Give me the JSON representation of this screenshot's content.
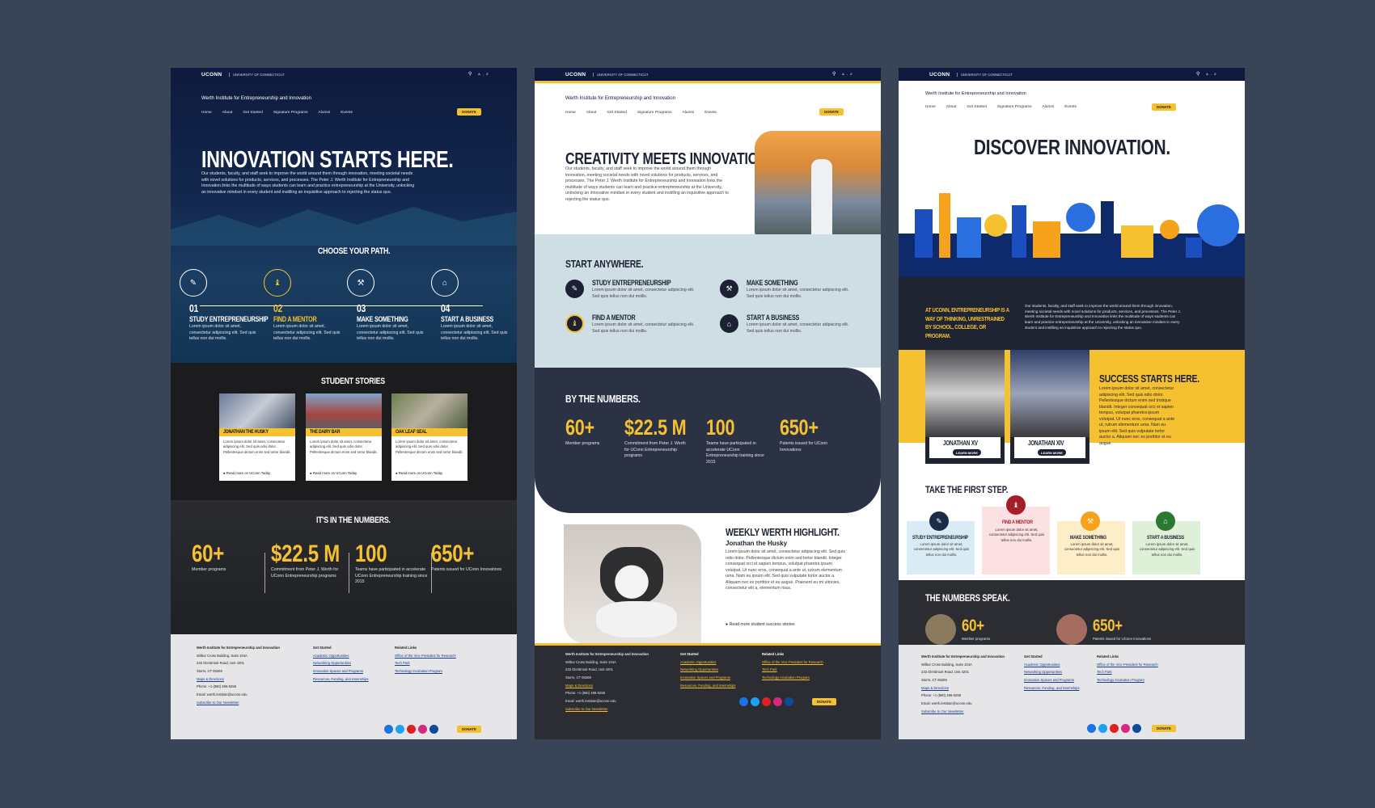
{
  "brand": {
    "logo": "UCONN",
    "university": "UNIVERSITY OF CONNECTICUT",
    "site": "Werth Institute for Entrepreneurship and Innovation",
    "search_icon": "⚲",
    "az": "A-Z"
  },
  "nav": [
    "Home",
    "About",
    "Get Started",
    "Signature Programs",
    "Alumni",
    "Events"
  ],
  "donate": "DONATE",
  "intro": "Our students, faculty, and staff seek to improve the world around them through innovation, meeting societal needs with novel solutions for products, services, and processes. The Peter J. Werth Institute for Entrepreneurship and Innovation links the multitude of ways students can learn and practice entrepreneurship at the University, unlocking an innovative mindset in every student and instilling an inquisitive approach to rejecting the status quo.",
  "lorem_short": "Lorem ipsum dolor sit amet, consectetur adipiscing elit. Sed quis tellus non dui mollis.",
  "paths": [
    {
      "num": "01",
      "title": "STUDY ENTREPRENEURSHIP"
    },
    {
      "num": "02",
      "title": "FIND A MENTOR"
    },
    {
      "num": "03",
      "title": "MAKE SOMETHING"
    },
    {
      "num": "04",
      "title": "START A BUSINESS"
    }
  ],
  "stats": [
    {
      "value": "60+",
      "label": "Member programs"
    },
    {
      "value": "$22.5 M",
      "label": "Commitment from Peter J. Werth for UConn Entrepreneurship programs"
    },
    {
      "value": "100",
      "label": "Teams have participated in accelerate UConn Entrepreneurship training since 2015"
    },
    {
      "value": "650+",
      "label": "Patents issued for UConn Innovations"
    }
  ],
  "p1": {
    "hero": "INNOVATION STARTS HERE.",
    "choose": "CHOOSE YOUR PATH.",
    "stories_title": "STUDENT STORIES",
    "stories": [
      {
        "title": "JONATHAN THE HUSKY"
      },
      {
        "title": "THE DAIRY BAR"
      },
      {
        "title": "OAK LEAF SEAL"
      }
    ],
    "story_body": "Lorem ipsum dolor sit amet, consectetur adipiscing elit. Sed quis odio dolor. Pellentesque dictum enim sed tortor blandit.",
    "read_more": "Read more on UConn Today",
    "numbers_title": "IT'S IN THE NUMBERS."
  },
  "p2": {
    "hero": "CREATIVITY MEETS INNOVATION.",
    "start": "START ANYWHERE.",
    "by_numbers": "BY THE NUMBERS.",
    "weekly": "WEEKLY WERTH HIGHLIGHT.",
    "husky": "Jonathan the Husky",
    "husky_body": "Lorem ipsum dolor sit amet, consectetur adipiscing elit. Sed quis odio dolor. Pellentesque dictum enim sed tortor blandit. Integer consequat orci et sapien tempus, volutpat pharetra ipsum volutpat. Ut nunc eros, consequat a ante ut, rutrum elementum urna. Nam eu ipsum elit. Sed quis vulputate tortor auctor a. Aliquam nec ex porttitor et eu augue. Praesent eu mi ultricies, consectetur elit a, elementum risus.",
    "read_more": "Read more student success stories"
  },
  "p3": {
    "hero": "DISCOVER INNOVATION.",
    "lead": "AT UCONN, ENTREPRENEURSHIP IS A WAY OF THINKING, UNRESTRAINED BY SCHOOL, COLLEGE, OR PROGRAM.",
    "dogs": [
      {
        "name": "JONATHAN XV",
        "btn": "LEARN MORE"
      },
      {
        "name": "JONATHAN XIV",
        "btn": "LEARN MORE"
      }
    ],
    "success": "SUCCESS STARTS HERE.",
    "success_body": "Lorem ipsum dolor sit amet, consectetur adipiscing elit. Sed quis odio dolor. Pellentesque dictum enim sed tristique blandit. Integer consequat orci et sapien tempus, volutpat pharetra ipsum volutpat. Ut nunc eros, consequat a ante ut, rutrum elementum urna. Nam eu ipsum elit. Sed quis vulputate tortor auctor a. Aliquam nec ex porttitor et eu augue.",
    "first_step": "TAKE THE FIRST STEP.",
    "numbers_speak": "THE NUMBERS SPEAK."
  },
  "footer": {
    "title": "Werth Institute for Entrepreneurship and Innovation",
    "addr1": "Wilbur Cross Building, Suite 104A",
    "addr2": "233 Glenbrook Road, Unit 4201",
    "addr3": "Storrs, CT 06269",
    "maps": "Maps & Directions",
    "phone": "Phone: +1 (860) 486-5258",
    "email": "Email: werth.institute@uconn.edu",
    "subscribe": "Subscribe to Our Newsletter",
    "gs_title": "Get Started",
    "gs": [
      "Academic Opportunities",
      "Networking Opportunities",
      "Innovation Spaces and Programs",
      "Resources, Funding, and Internships"
    ],
    "rl_title": "Related Links",
    "rl": [
      "Office of the Vice President for Research",
      "Tech Park",
      "Technology Incubation Program"
    ]
  },
  "colors": {
    "navy": "#0e1a3d",
    "gold": "#f6c131",
    "slate": "#2b3244",
    "page_bg": "#3a4457"
  }
}
